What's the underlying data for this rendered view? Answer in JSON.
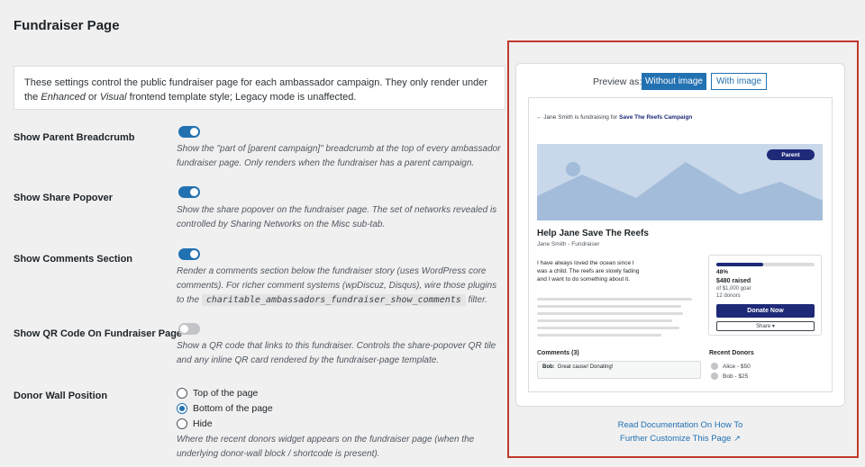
{
  "page": {
    "title": "Fundraiser Page"
  },
  "intro": {
    "part1": "These settings control the public fundraiser page for each ambassador campaign. They only render under the ",
    "em1": "Enhanced",
    "part2": " or ",
    "em2": "Visual",
    "part3": " frontend template style; Legacy mode is unaffected."
  },
  "settings": {
    "breadcrumb": {
      "label": "Show Parent Breadcrumb",
      "desc": "Show the \"part of [parent campaign]\" breadcrumb at the top of every ambassador fundraiser page. Only renders when the fundraiser has a parent campaign.",
      "enabled": true
    },
    "share": {
      "label": "Show Share Popover",
      "desc": "Show the share popover on the fundraiser page. The set of networks revealed is controlled by Sharing Networks on the Misc sub-tab.",
      "enabled": true
    },
    "comments": {
      "label": "Show Comments Section",
      "desc_part1": "Render a comments section below the fundraiser story (uses WordPress core comments). For richer comment systems (wpDiscuz, Disqus), wire those plugins to the ",
      "code": "charitable_ambassadors_fundraiser_show_comments",
      "desc_part2": " filter.",
      "enabled": true
    },
    "qr": {
      "label": "Show QR Code On Fundraiser Page",
      "desc": "Show a QR code that links to this fundraiser. Controls the share-popover QR tile and any inline QR card rendered by the fundraiser-page template.",
      "enabled": false
    },
    "donor_wall": {
      "label": "Donor Wall Position",
      "options": [
        "Top of the page",
        "Bottom of the page",
        "Hide"
      ],
      "selected": "Bottom of the page",
      "desc": "Where the recent donors widget appears on the fundraiser page (when the underlying donor-wall block / shortcode is present)."
    }
  },
  "preview": {
    "label": "Preview as:",
    "btn_without": "Without image",
    "btn_with": "With image",
    "active": "Without image",
    "crumb_prefix": "← Jane Smith is fundraising for ",
    "crumb_campaign": "Save The Reefs Campaign",
    "parent_pill": "Parent",
    "fundraiser_title": "Help Jane Save The Reefs",
    "fundraiser_sub": "Jane Smith - Fundraiser",
    "story": "I have always loved the ocean since I was a child. The reefs are slowly fading and I want to do something about it.",
    "progress": 0.48,
    "pct": "48%",
    "raised": "$480 raised",
    "goal": "of $1,000 goal",
    "donors": "12 donors",
    "donate_btn": "Donate Now",
    "share_btn": "Share ▾",
    "comments_title": "Comments (3)",
    "comment_author": "Bob:",
    "comment_text": "Great cause! Donating!",
    "recent_title": "Recent Donors",
    "recent": [
      "Alice - $50",
      "Bob - $25"
    ]
  },
  "doc": {
    "line1": "Read Documentation On How To",
    "line2": "Further Customize This Page",
    "icon": "external-link-icon"
  },
  "colors": {
    "accent": "#2271b1",
    "navy": "#1e2a78",
    "highlight": "#c0392b"
  }
}
